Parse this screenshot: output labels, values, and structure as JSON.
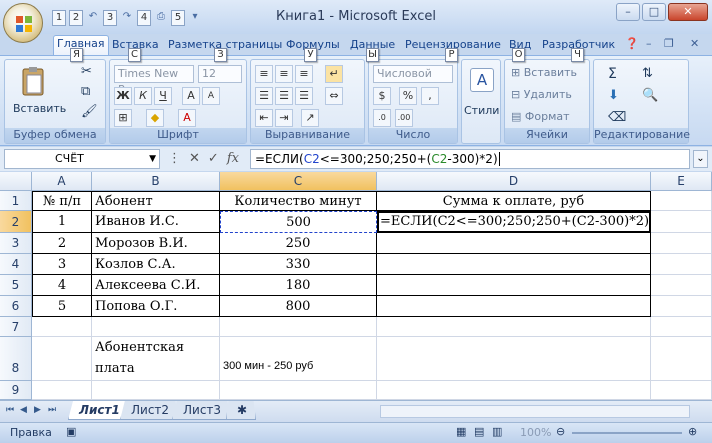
{
  "window": {
    "title": "Книга1 - Microsoft Excel",
    "qat_keytips": [
      "1",
      "2",
      "3",
      "4",
      "5"
    ],
    "buttons": {
      "minimize": "–",
      "maximize": "□",
      "close": "✕"
    }
  },
  "tabs": [
    {
      "label": "Главная",
      "keytip": "Я"
    },
    {
      "label": "Вставка",
      "keytip": "С"
    },
    {
      "label": "Разметка страницы",
      "keytip": "З"
    },
    {
      "label": "Формулы",
      "keytip": "У"
    },
    {
      "label": "Данные",
      "keytip": "Ы"
    },
    {
      "label": "Рецензирование",
      "keytip": "Р"
    },
    {
      "label": "Вид",
      "keytip": "О"
    },
    {
      "label": "Разработчик",
      "keytip": "Ч"
    }
  ],
  "ribbon": {
    "clipboard": {
      "paste": "Вставить",
      "label": "Буфер обмена"
    },
    "font": {
      "name": "Times New Ro",
      "size": "12",
      "label": "Шрифт"
    },
    "alignment": {
      "label": "Выравнивание"
    },
    "number": {
      "format": "Числовой",
      "label": "Число"
    },
    "styles": {
      "label": "Стили"
    },
    "cells": {
      "insert": "Вставить",
      "delete": "Удалить",
      "format": "Формат",
      "label": "Ячейки"
    },
    "editing": {
      "label": "Редактирование"
    }
  },
  "formula_bar": {
    "name_box": "СЧЁТ",
    "fx": "fx",
    "formula_parts": [
      "=ЕСЛИ(",
      "C2",
      "<=300;250;250+(",
      "C2",
      "-300)*2)"
    ]
  },
  "sheet": {
    "columns": [
      "A",
      "B",
      "C",
      "D",
      "E"
    ],
    "rows": [
      "1",
      "2",
      "3",
      "4",
      "5",
      "6",
      "7",
      "8",
      "9"
    ],
    "header_row": [
      "№ п/п",
      "Абонент",
      "Количество минут",
      "Сумма к оплате, руб"
    ],
    "data": [
      [
        "1",
        "Иванов И.С.",
        "500",
        "=ЕСЛИ(C2<=300;250;250+(C2-300)*2)"
      ],
      [
        "2",
        "Морозов В.И.",
        "250",
        ""
      ],
      [
        "3",
        "Козлов С.А.",
        "330",
        ""
      ],
      [
        "4",
        "Алексеева С.И.",
        "180",
        ""
      ],
      [
        "5",
        "Попова О.Г.",
        "800",
        ""
      ]
    ],
    "note_label_line1": "Абонентская",
    "note_label_line2": "плата",
    "note_value": "300 мин - 250 руб"
  },
  "sheet_tabs": [
    "Лист1",
    "Лист2",
    "Лист3"
  ],
  "status": {
    "mode": "Правка",
    "zoom": "100%"
  }
}
